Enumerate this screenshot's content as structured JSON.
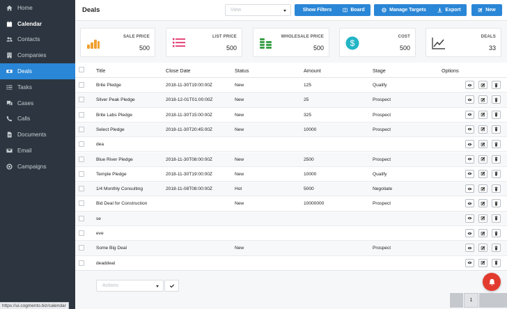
{
  "sidebar": {
    "items": [
      {
        "label": "Home",
        "icon": "home-icon"
      },
      {
        "label": "Calendar",
        "icon": "calendar-icon"
      },
      {
        "label": "Contacts",
        "icon": "users-icon"
      },
      {
        "label": "Companies",
        "icon": "building-icon"
      },
      {
        "label": "Deals",
        "icon": "money-icon"
      },
      {
        "label": "Tasks",
        "icon": "list-icon"
      },
      {
        "label": "Cases",
        "icon": "chat-icon"
      },
      {
        "label": "Calls",
        "icon": "phone-icon"
      },
      {
        "label": "Documents",
        "icon": "document-icon"
      },
      {
        "label": "Email",
        "icon": "envelope-icon"
      },
      {
        "label": "Campaigns",
        "icon": "target-icon"
      }
    ],
    "active": "Deals",
    "status_url": "https://ui.cogmento.biz/calendar"
  },
  "header": {
    "title": "Deals",
    "view_placeholder": "View",
    "buttons": {
      "show_filters": "Show Filters",
      "board": "Board",
      "manage_targets": "Manage Targets",
      "export": "Export",
      "new": "New"
    }
  },
  "stats": {
    "sale_price": {
      "label": "SALE PRICE",
      "value": "500"
    },
    "list_price": {
      "label": "LIST PRICE",
      "value": "500"
    },
    "wholesale_price": {
      "label": "WHOLESALE PRICE",
      "value": "500"
    },
    "cost": {
      "label": "COST",
      "value": "500"
    },
    "deals": {
      "label": "DEALS",
      "value": "33"
    }
  },
  "table": {
    "columns": [
      "Title",
      "Close Date",
      "Status",
      "Amount",
      "Stage",
      "Options"
    ],
    "rows": [
      [
        "Brite Pledge",
        "2018-11-30T19:00:00Z",
        "New",
        "125",
        "Qualify"
      ],
      [
        "Silver Peak Pledge",
        "2018-12-01T01:00:00Z",
        "New",
        "25",
        "Prospect"
      ],
      [
        "Brite Labs Pledge",
        "2018-11-30T15:00:00Z",
        "New",
        "325",
        "Prospect"
      ],
      [
        "Select Pledge",
        "2018-11-30T20:45:00Z",
        "New",
        "10000",
        "Prospect"
      ],
      [
        "dea",
        "",
        "",
        "",
        ""
      ],
      [
        "Blue River Pledge",
        "2018-11-30T08:00:00Z",
        "New",
        "2500",
        "Prospect"
      ],
      [
        "Temple Pledge",
        "2018-11-30T19:00:00Z",
        "New",
        "10000",
        "Qualify"
      ],
      [
        "1/4 Monthly Consulting",
        "2018-11-08T08:00:00Z",
        "Hot",
        "5000",
        "Negotiate"
      ],
      [
        "Bid Deal for Construction",
        "",
        "New",
        "10000000",
        "Prospect"
      ],
      [
        "se",
        "",
        "",
        "",
        ""
      ],
      [
        "eve",
        "",
        "",
        "",
        ""
      ],
      [
        "Some Big Deal",
        "",
        "New",
        "",
        "Prospect"
      ],
      [
        "deaddeal",
        "",
        "",
        "",
        ""
      ]
    ]
  },
  "footer": {
    "actions_placeholder": "Actions",
    "current_page": "1"
  },
  "colors": {
    "accent": "#2a86d6",
    "sidebar_bg": "#2d3640",
    "notification": "#e23b2e",
    "stat_orange": "#f0a030",
    "stat_pink": "#e0306a",
    "stat_green": "#3aa048",
    "stat_teal": "#22b5c6"
  }
}
